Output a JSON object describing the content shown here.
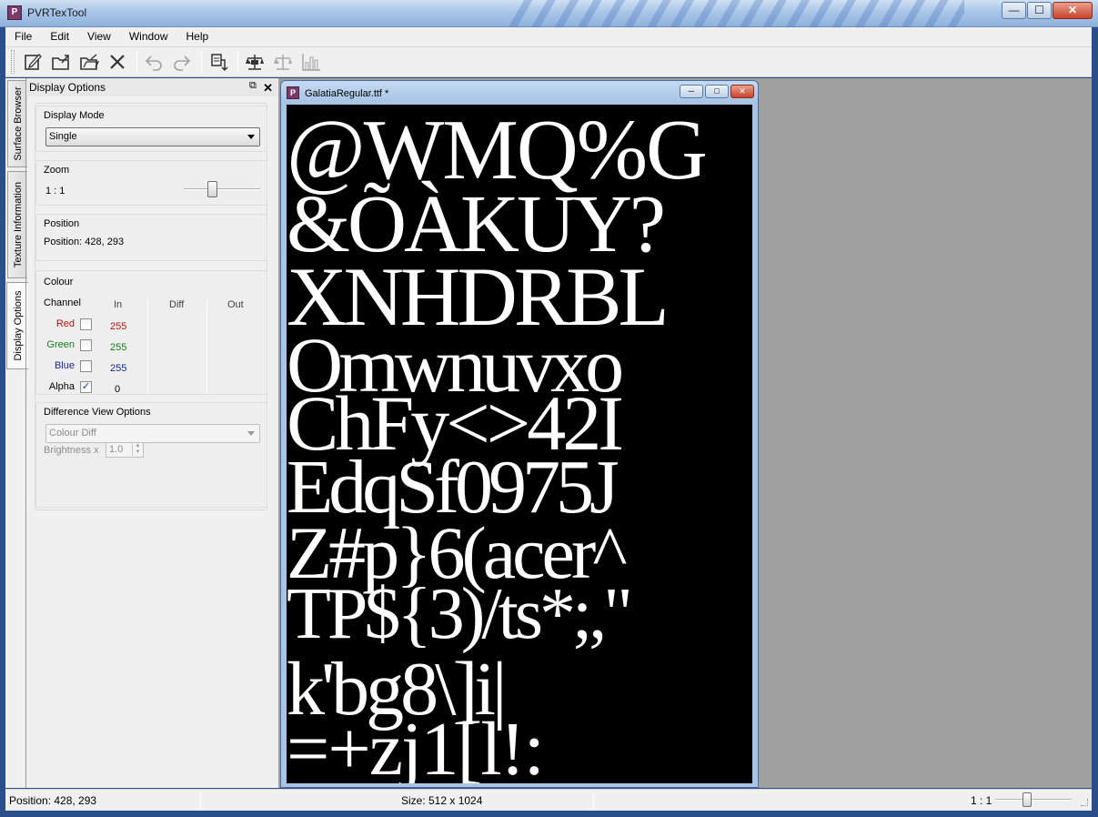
{
  "window": {
    "title": "PVRTexTool",
    "minimize": "—",
    "maximize": "☐",
    "close": "✕"
  },
  "menu": [
    "File",
    "Edit",
    "View",
    "Window",
    "Help"
  ],
  "toolbar": {
    "buttons": [
      {
        "name": "new-icon"
      },
      {
        "name": "open-icon"
      },
      {
        "name": "open-folder-icon"
      },
      {
        "name": "close-icon"
      },
      {
        "name": "undo-icon"
      },
      {
        "name": "redo-icon"
      },
      {
        "name": "encode-icon"
      },
      {
        "name": "compare-icon"
      },
      {
        "name": "compare-diff-icon"
      },
      {
        "name": "histogram-icon"
      }
    ]
  },
  "side_tabs": [
    "Surface Browser",
    "Texture Information",
    "Display Options"
  ],
  "dock": {
    "title": "Display Options",
    "display_mode": {
      "label": "Display Mode",
      "value": "Single"
    },
    "zoom": {
      "label": "Zoom",
      "value": "1 : 1",
      "level": 0.35
    },
    "position": {
      "label": "Position",
      "value": "Position: 428, 293"
    },
    "colour": {
      "label": "Colour",
      "headers": {
        "channel": "Channel",
        "in": "In",
        "diff": "Diff",
        "out": "Out"
      },
      "channels": [
        {
          "name": "Red",
          "checked": false,
          "value": "255",
          "color": "#b01010"
        },
        {
          "name": "Green",
          "checked": false,
          "value": "255",
          "color": "#1a7a1a"
        },
        {
          "name": "Blue",
          "checked": false,
          "value": "255",
          "color": "#1a2a8a"
        },
        {
          "name": "Alpha",
          "checked": true,
          "value": "0",
          "color": "#000000"
        }
      ]
    },
    "difference": {
      "label": "Difference View Options",
      "mode": "Colour Diff",
      "brightness_label": "Brightness x",
      "brightness_value": "1.0"
    }
  },
  "document": {
    "title": "GalatiaRegular.ttf *",
    "glyph_rows": [
      "@WMQ%G",
      "&ÕÀKUY?",
      "XNHDRBL",
      "Omwnuvxo",
      "ChFy<>42I",
      "EdqSf0975J",
      "Z#p}6(acer^",
      "TP${3)/ts*;,\"",
      "k'bg8\\]i|",
      "=+zj1[l!:"
    ]
  },
  "status": {
    "position": "Position: 428, 293",
    "size": "Size: 512 x 1024",
    "zoom": "1 : 1",
    "zoom_level": 0.4
  }
}
